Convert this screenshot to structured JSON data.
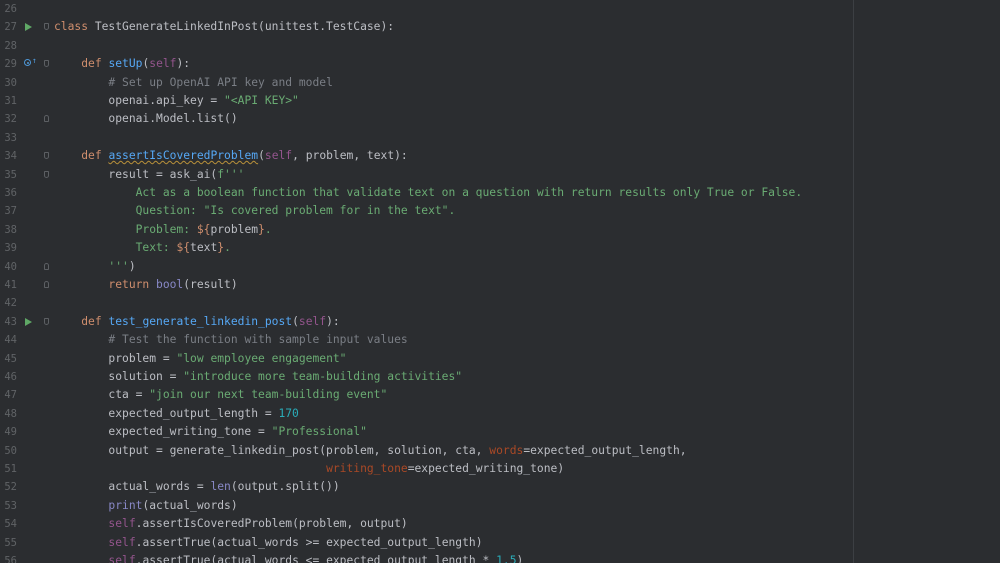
{
  "editor": {
    "colors": {
      "background": "#2b2d30",
      "keyword": "#cf8e6d",
      "function": "#56a8f5",
      "string": "#6aab73",
      "comment": "#7a7e85",
      "self": "#94558d",
      "number": "#2aacb8"
    },
    "lines": [
      {
        "n": "26",
        "tokens": []
      },
      {
        "n": "27",
        "run": true,
        "fold": "start",
        "tokens": [
          {
            "t": "class ",
            "c": "kw"
          },
          {
            "t": "TestGenerateLinkedInPost(unittest.TestCase):"
          }
        ]
      },
      {
        "n": "28",
        "tokens": []
      },
      {
        "n": "29",
        "override": true,
        "fold": "start",
        "tokens": [
          {
            "t": "    "
          },
          {
            "t": "def ",
            "c": "kw"
          },
          {
            "t": "setUp",
            "c": "fn"
          },
          {
            "t": "("
          },
          {
            "t": "self",
            "c": "self"
          },
          {
            "t": "):"
          }
        ]
      },
      {
        "n": "30",
        "tokens": [
          {
            "t": "        "
          },
          {
            "t": "# Set up OpenAI API key and model",
            "c": "cm"
          }
        ]
      },
      {
        "n": "31",
        "tokens": [
          {
            "t": "        openai.api_key = "
          },
          {
            "t": "\"<API KEY>\"",
            "c": "str"
          }
        ]
      },
      {
        "n": "32",
        "fold": "end",
        "tokens": [
          {
            "t": "        openai.Model.list()"
          }
        ]
      },
      {
        "n": "33",
        "tokens": []
      },
      {
        "n": "34",
        "fold": "start",
        "tokens": [
          {
            "t": "    "
          },
          {
            "t": "def ",
            "c": "kw"
          },
          {
            "t": "assertIsCoveredProblem",
            "c": "fn warn"
          },
          {
            "t": "("
          },
          {
            "t": "self",
            "c": "self"
          },
          {
            "t": ", problem, text):"
          }
        ]
      },
      {
        "n": "35",
        "fold": "start",
        "tokens": [
          {
            "t": "        result = ask_ai("
          },
          {
            "t": "f'''",
            "c": "str"
          }
        ]
      },
      {
        "n": "36",
        "tokens": [
          {
            "t": "            Act as a boolean function that validate text on a question with return results only True or False.",
            "c": "str"
          }
        ]
      },
      {
        "n": "37",
        "tokens": [
          {
            "t": "            Question: \"Is covered problem for in the text\".",
            "c": "str"
          }
        ]
      },
      {
        "n": "38",
        "tokens": [
          {
            "t": "            Problem: ",
            "c": "str"
          },
          {
            "t": "${",
            "c": "kw"
          },
          {
            "t": "problem"
          },
          {
            "t": "}",
            "c": "kw"
          },
          {
            "t": ".",
            "c": "str"
          }
        ]
      },
      {
        "n": "39",
        "tokens": [
          {
            "t": "            Text: ",
            "c": "str"
          },
          {
            "t": "${",
            "c": "kw"
          },
          {
            "t": "text"
          },
          {
            "t": "}",
            "c": "kw"
          },
          {
            "t": ".",
            "c": "str"
          }
        ]
      },
      {
        "n": "40",
        "fold": "end",
        "tokens": [
          {
            "t": "        "
          },
          {
            "t": "'''",
            "c": "str"
          },
          {
            "t": ")"
          }
        ]
      },
      {
        "n": "41",
        "fold": "end",
        "tokens": [
          {
            "t": "        "
          },
          {
            "t": "return ",
            "c": "kw"
          },
          {
            "t": "bool",
            "c": "bi"
          },
          {
            "t": "(result)"
          }
        ]
      },
      {
        "n": "42",
        "tokens": []
      },
      {
        "n": "43",
        "run": true,
        "fold": "start",
        "tokens": [
          {
            "t": "    "
          },
          {
            "t": "def ",
            "c": "kw"
          },
          {
            "t": "test_generate_linkedin_post",
            "c": "fn"
          },
          {
            "t": "("
          },
          {
            "t": "self",
            "c": "self"
          },
          {
            "t": "):"
          }
        ]
      },
      {
        "n": "44",
        "tokens": [
          {
            "t": "        "
          },
          {
            "t": "# Test the function with sample input values",
            "c": "cm"
          }
        ]
      },
      {
        "n": "45",
        "tokens": [
          {
            "t": "        problem = "
          },
          {
            "t": "\"low employee engagement\"",
            "c": "str"
          }
        ]
      },
      {
        "n": "46",
        "tokens": [
          {
            "t": "        solution = "
          },
          {
            "t": "\"introduce more team-building activities\"",
            "c": "str"
          }
        ]
      },
      {
        "n": "47",
        "tokens": [
          {
            "t": "        cta = "
          },
          {
            "t": "\"join our next team-building event\"",
            "c": "str"
          }
        ]
      },
      {
        "n": "48",
        "tokens": [
          {
            "t": "        expected_output_length = "
          },
          {
            "t": "170",
            "c": "num"
          }
        ]
      },
      {
        "n": "49",
        "tokens": [
          {
            "t": "        expected_writing_tone = "
          },
          {
            "t": "\"Professional\"",
            "c": "str"
          }
        ]
      },
      {
        "n": "50",
        "tokens": [
          {
            "t": "        output = generate_linkedin_post(problem, solution, cta, "
          },
          {
            "t": "words",
            "c": "kwarg"
          },
          {
            "t": "=expected_output_length,"
          }
        ]
      },
      {
        "n": "51",
        "tokens": [
          {
            "t": "                                        "
          },
          {
            "t": "writing_tone",
            "c": "kwarg"
          },
          {
            "t": "=expected_writing_tone)"
          }
        ]
      },
      {
        "n": "52",
        "tokens": [
          {
            "t": "        actual_words = "
          },
          {
            "t": "len",
            "c": "bi"
          },
          {
            "t": "(output.split())"
          }
        ]
      },
      {
        "n": "53",
        "tokens": [
          {
            "t": "        "
          },
          {
            "t": "print",
            "c": "bi"
          },
          {
            "t": "(actual_words)"
          }
        ]
      },
      {
        "n": "54",
        "tokens": [
          {
            "t": "        "
          },
          {
            "t": "self",
            "c": "self"
          },
          {
            "t": ".assertIsCoveredProblem(problem, output)"
          }
        ]
      },
      {
        "n": "55",
        "tokens": [
          {
            "t": "        "
          },
          {
            "t": "self",
            "c": "self"
          },
          {
            "t": ".assertTrue(actual_words >= expected_output_length)"
          }
        ]
      },
      {
        "n": "56",
        "tokens": [
          {
            "t": "        "
          },
          {
            "t": "self",
            "c": "self"
          },
          {
            "t": ".assertTrue(actual_words <= expected_output_length * "
          },
          {
            "t": "1.5",
            "c": "num"
          },
          {
            "t": ")"
          }
        ]
      }
    ]
  }
}
